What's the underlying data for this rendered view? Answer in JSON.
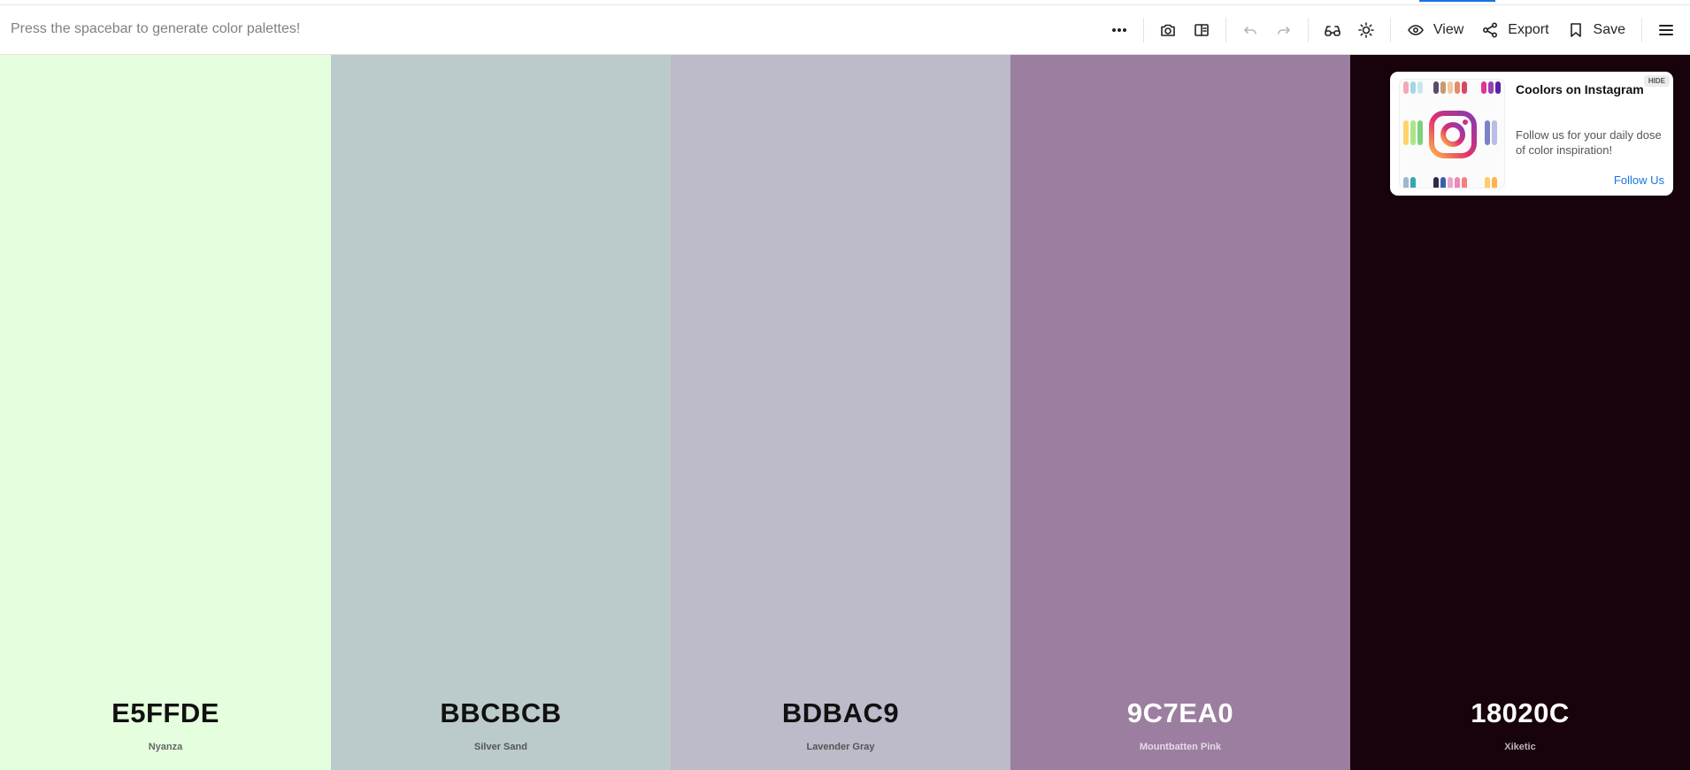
{
  "toolbar": {
    "hint": "Press the spacebar to generate color palettes!",
    "view_label": "View",
    "export_label": "Export",
    "save_label": "Save",
    "icons": [
      "more-icon",
      "camera-icon",
      "split-view-icon",
      "undo-icon",
      "redo-icon",
      "glasses-icon",
      "sun-icon",
      "eye-icon",
      "share-icon",
      "bookmark-icon",
      "menu-icon"
    ]
  },
  "palette": [
    {
      "hex": "E5FFDE",
      "name": "Nyanza",
      "bg": "#E5FFDE",
      "text": "#111111",
      "subtext": "#666666"
    },
    {
      "hex": "BBCBCB",
      "name": "Silver Sand",
      "bg": "#BBCBCB",
      "text": "#111111",
      "subtext": "#555555"
    },
    {
      "hex": "BDBAC9",
      "name": "Lavender Gray",
      "bg": "#BDBAC9",
      "text": "#111111",
      "subtext": "#555555"
    },
    {
      "hex": "9C7EA0",
      "name": "Mountbatten Pink",
      "bg": "#9C7EA0",
      "text": "#FFFFFF",
      "subtext": "#E4DCE6"
    },
    {
      "hex": "18020C",
      "name": "Xiketic",
      "bg": "#18020C",
      "text": "#FFFFFF",
      "subtext": "#BFB5BA"
    }
  ],
  "ad": {
    "hide_label": "HIDE",
    "title": "Coolors on Instagram",
    "description": "Follow us for your daily dose of color inspiration!",
    "cta": "Follow Us",
    "logo_icon": "instagram-logo-icon"
  },
  "colors": {
    "accent": "#1a73e8"
  }
}
